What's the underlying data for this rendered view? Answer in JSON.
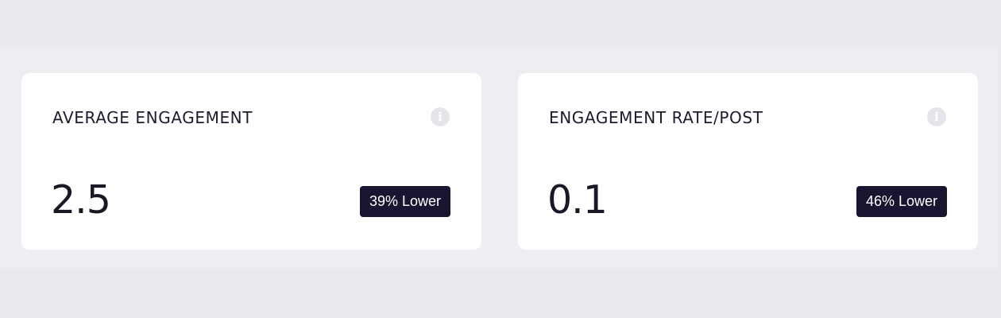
{
  "cards": [
    {
      "title": "AVERAGE ENGAGEMENT",
      "value": "2.5",
      "badge": "39% Lower",
      "info_icon": "info-icon"
    },
    {
      "title": "ENGAGEMENT RATE/POST",
      "value": "0.1",
      "badge": "46% Lower",
      "info_icon": "info-icon"
    }
  ],
  "colors": {
    "page_background": "#e9eaef",
    "card_background": "#ffffff",
    "badge_background": "#171530",
    "badge_text": "#ffffff",
    "info_icon_background": "#e4e5ea",
    "text_primary": "#1b1b2e"
  }
}
